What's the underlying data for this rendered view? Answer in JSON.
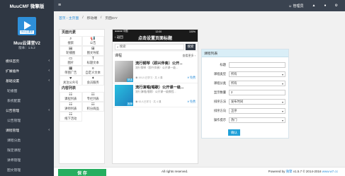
{
  "app": {
    "brand": "MuuCMF 微擎版"
  },
  "topbar": {
    "menu_icon": "menu-icon",
    "items": [
      "☺ 管理员",
      "▲",
      "●",
      "⚙"
    ]
  },
  "sidebar": {
    "logo_text": "Muu云课堂",
    "site_name": "Muu云课堂V2",
    "version": "版本：1.5.2",
    "items": [
      {
        "label": "模块首页",
        "chev": "‹"
      },
      {
        "label": "扩展插件",
        "chev": "‹"
      },
      {
        "label": "基础设置",
        "chev": "‹"
      },
      {
        "label": "轮播图"
      },
      {
        "label": "系统配置"
      },
      {
        "label": "公告管理",
        "chev": "‹"
      },
      {
        "label": "公告管理"
      },
      {
        "label": "课程管理",
        "chev": "‹"
      },
      {
        "label": "课程分类"
      },
      {
        "label": "限定课程"
      },
      {
        "label": "讲师管理"
      },
      {
        "label": "图文管理"
      }
    ]
  },
  "breadcrumb": {
    "home": "首页 › 主页面",
    "item1": "移动端",
    "item2": "页面DIY",
    "sep": "/"
  },
  "palette": {
    "title1": "页面元素",
    "elements": [
      {
        "icon": "⌕",
        "label": "搜索"
      },
      {
        "icon": "📢",
        "label": "公告"
      },
      {
        "icon": "▤",
        "label": "轮播图"
      },
      {
        "icon": "⊞",
        "label": "图文导航"
      },
      {
        "icon": "▭",
        "label": "图片"
      },
      {
        "icon": "T",
        "label": "标题文本"
      },
      {
        "icon": "▦",
        "label": "单图广告"
      },
      {
        "icon": "≡",
        "label": "自定义文本"
      },
      {
        "icon": "♥",
        "label": "关注公众号"
      },
      {
        "icon": "✦",
        "label": "会员服务"
      }
    ],
    "title2": "内容列表",
    "lists": [
      {
        "icon": "☷",
        "label": "课程列表"
      },
      {
        "icon": "☷",
        "label": "专栏列表"
      },
      {
        "icon": "☷",
        "label": "讲师列表"
      },
      {
        "icon": "☷",
        "label": "积分商品"
      },
      {
        "icon": "☷",
        "label": "线下活动"
      }
    ]
  },
  "phone": {
    "status_left": "●●●●● 中国",
    "status_mid": "12:00",
    "status_right": "100%",
    "back": "‹ 返回",
    "title": "点击设置页面标题",
    "search_placeholder": "搜索",
    "search_btn": "搜索",
    "section": "课程",
    "more": "查看更多 ›",
    "courses": [
      {
        "title": "流行钢琴（即兴伴奏）公开...",
        "desc": "流行钢琴（即兴伴奏）公开课一级...",
        "meta": "◉ 191人已学习 · 共 4 课",
        "price": "¥ 免费",
        "tag": "精选"
      },
      {
        "title": "流行演唱(唱歌）公开课一级...",
        "desc": "流行演唱(唱歌）公开课一级教程...",
        "meta": "◉ 92人已学习 · 共 4 课",
        "price": "¥ 免费",
        "tag": "推荐"
      }
    ]
  },
  "panel": {
    "title": "课程列表",
    "rows": [
      {
        "label": "标题",
        "value": ""
      },
      {
        "label": "课程类型",
        "value": "所有",
        "select": true
      },
      {
        "label": "课程分类",
        "value": "所有",
        "select": true
      },
      {
        "label": "显示数量",
        "value": "2"
      },
      {
        "label": "排序方法",
        "value": "发布时间",
        "select": true
      },
      {
        "label": "排序方向",
        "value": "正序",
        "select": true
      },
      {
        "label": "操作提示",
        "value": "热门",
        "select": true
      }
    ],
    "confirm": "确认"
  },
  "footer": {
    "save": "保 存",
    "copyright": "All rights reserved.",
    "powered_prefix": "Powered by",
    "powered_brand": "微擎",
    "powered_suffix": "v1.5.7 © 2014-2016",
    "powered_link": "www.w7.cc"
  }
}
